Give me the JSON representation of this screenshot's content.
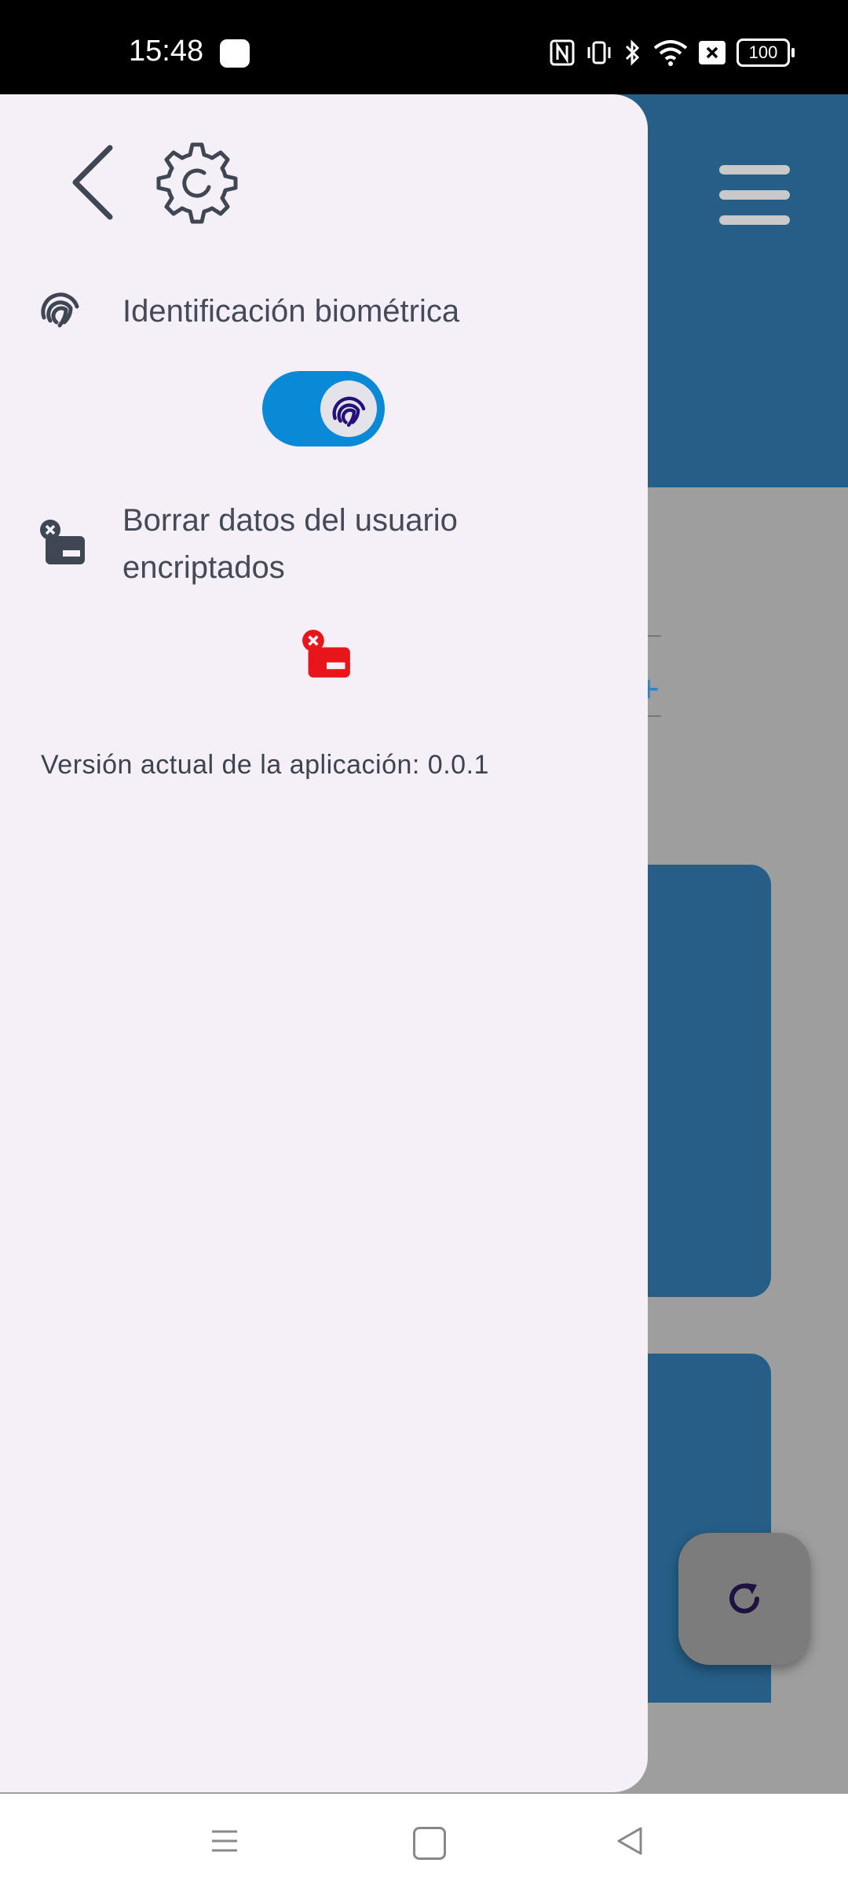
{
  "status_bar": {
    "time": "15:48",
    "icons": [
      "nfc-icon",
      "vibrate-icon",
      "bluetooth-icon",
      "wifi-icon",
      "sim-off-icon"
    ],
    "battery": "100"
  },
  "drawer": {
    "biometric": {
      "label": "Identificación biométrica",
      "enabled": true
    },
    "erase": {
      "label": "Borrar datos del usuario encriptados"
    },
    "version_text": "Versión actual de la aplicación: 0.0.1"
  },
  "colors": {
    "drawer_bg": "#f5f0f8",
    "toggle_on": "#0a8ad6",
    "erase_red": "#e8151b",
    "app_primary": "#255e87"
  }
}
